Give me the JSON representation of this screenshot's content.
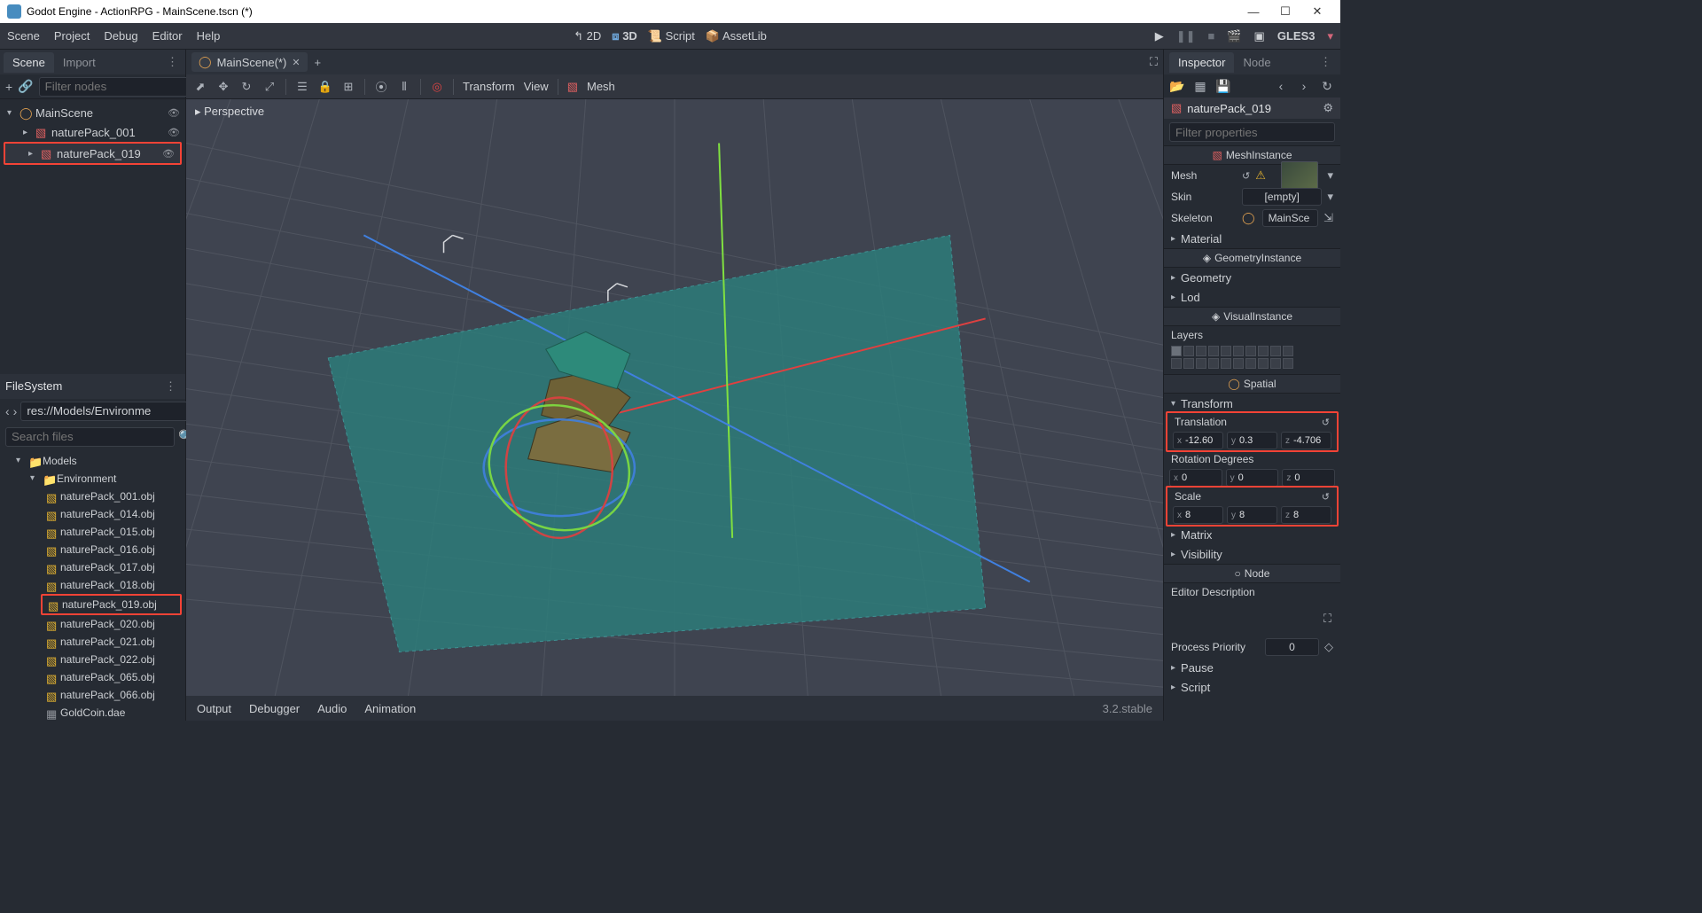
{
  "titlebar": {
    "title": "Godot Engine - ActionRPG - MainScene.tscn (*)"
  },
  "menubar": {
    "left": [
      "Scene",
      "Project",
      "Debug",
      "Editor",
      "Help"
    ],
    "center": {
      "d2": "2D",
      "d3": "3D",
      "script": "Script",
      "assetlib": "AssetLib"
    },
    "gles": "GLES3"
  },
  "scene_dock": {
    "tabs": {
      "scene": "Scene",
      "import": "Import"
    },
    "filter_placeholder": "Filter nodes",
    "tree": [
      {
        "lvl": 0,
        "label": "MainScene",
        "caret": "▾",
        "icon": "spatial"
      },
      {
        "lvl": 1,
        "label": "naturePack_001",
        "caret": "▸",
        "icon": "mesh"
      },
      {
        "lvl": 1,
        "label": "naturePack_019",
        "caret": "▸",
        "icon": "mesh",
        "highlight": true
      }
    ]
  },
  "filesystem": {
    "title": "FileSystem",
    "path": "res://Models/Environme",
    "search_placeholder": "Search files",
    "tree": [
      {
        "lvl": 0,
        "type": "folder",
        "label": "Models",
        "caret": "▾"
      },
      {
        "lvl": 1,
        "type": "folder",
        "label": "Environment",
        "caret": "▾"
      },
      {
        "lvl": 2,
        "type": "mesh",
        "label": "naturePack_001.obj"
      },
      {
        "lvl": 2,
        "type": "mesh",
        "label": "naturePack_014.obj"
      },
      {
        "lvl": 2,
        "type": "mesh",
        "label": "naturePack_015.obj"
      },
      {
        "lvl": 2,
        "type": "mesh",
        "label": "naturePack_016.obj"
      },
      {
        "lvl": 2,
        "type": "mesh",
        "label": "naturePack_017.obj"
      },
      {
        "lvl": 2,
        "type": "mesh",
        "label": "naturePack_018.obj"
      },
      {
        "lvl": 2,
        "type": "mesh",
        "label": "naturePack_019.obj",
        "highlight": true
      },
      {
        "lvl": 2,
        "type": "mesh",
        "label": "naturePack_020.obj"
      },
      {
        "lvl": 2,
        "type": "mesh",
        "label": "naturePack_021.obj"
      },
      {
        "lvl": 2,
        "type": "mesh",
        "label": "naturePack_022.obj"
      },
      {
        "lvl": 2,
        "type": "mesh",
        "label": "naturePack_065.obj"
      },
      {
        "lvl": 2,
        "type": "mesh",
        "label": "naturePack_066.obj"
      },
      {
        "lvl": 2,
        "type": "scene",
        "label": "GoldCoin.dae"
      }
    ]
  },
  "center": {
    "scene_tab": "MainScene(*)",
    "perspective": "Perspective",
    "toolbar": {
      "transform": "Transform",
      "view": "View",
      "mesh": "Mesh"
    }
  },
  "bottom": {
    "tabs": [
      "Output",
      "Debugger",
      "Audio",
      "Animation"
    ],
    "version": "3.2.stable"
  },
  "inspector": {
    "tabs": {
      "inspector": "Inspector",
      "node": "Node"
    },
    "node_name": "naturePack_019",
    "filter_placeholder": "Filter properties",
    "sections": {
      "meshinstance": "MeshInstance",
      "props": {
        "mesh": "Mesh",
        "skin": "Skin",
        "skin_val": "[empty]",
        "skeleton": "Skeleton",
        "skeleton_val": "MainSce"
      },
      "expanders": [
        "Material",
        "Geometry",
        "Lod"
      ],
      "geo_instance": "GeometryInstance",
      "visual_instance": "VisualInstance",
      "layers": "Layers",
      "spatial": "Spatial",
      "transform_exp": "Transform",
      "translation": "Translation",
      "translation_vals": {
        "x": "-12.60",
        "y": "0.3",
        "z": "-4.706"
      },
      "rotation": "Rotation Degrees",
      "rotation_vals": {
        "x": "0",
        "y": "0",
        "z": "0"
      },
      "scale": "Scale",
      "scale_vals": {
        "x": "8",
        "y": "8",
        "z": "8"
      },
      "matrix": "Matrix",
      "visibility": "Visibility",
      "node_section": "Node",
      "editor_desc": "Editor Description",
      "process_priority": "Process Priority",
      "process_priority_val": "0",
      "pause": "Pause",
      "script": "Script"
    }
  }
}
